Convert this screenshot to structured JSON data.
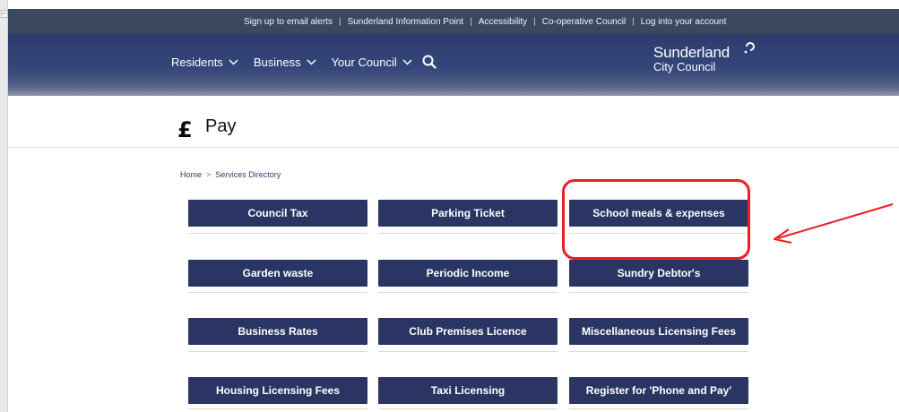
{
  "topbar": {
    "links": [
      "Sign up to email alerts",
      "Sunderland Information Point",
      "Accessibility",
      "Co-operative Council",
      "Log into your account"
    ],
    "separator": "|"
  },
  "nav": {
    "items": [
      "Residents",
      "Business",
      "Your Council"
    ],
    "search_icon": "search-icon"
  },
  "logo": {
    "line1": "Sunderland",
    "line2": "City Council"
  },
  "page": {
    "title": "Pay",
    "icon": "pound-icon"
  },
  "breadcrumb": {
    "home": "Home",
    "separator": ">",
    "current": "Services Directory"
  },
  "services": [
    "Council Tax",
    "Parking Ticket",
    "School meals & expenses",
    "Garden waste",
    "Periodic Income",
    "Sundry Debtor's",
    "Business Rates",
    "Club Premises Licence",
    "Miscellaneous Licensing Fees",
    "Housing Licensing Fees",
    "Taxi Licensing",
    "Register for 'Phone and Pay'"
  ],
  "colors": {
    "topbar": "#3a4960",
    "header": "#2d3c6c",
    "tile": "#2a3564",
    "annotation": "#ee1c23"
  }
}
